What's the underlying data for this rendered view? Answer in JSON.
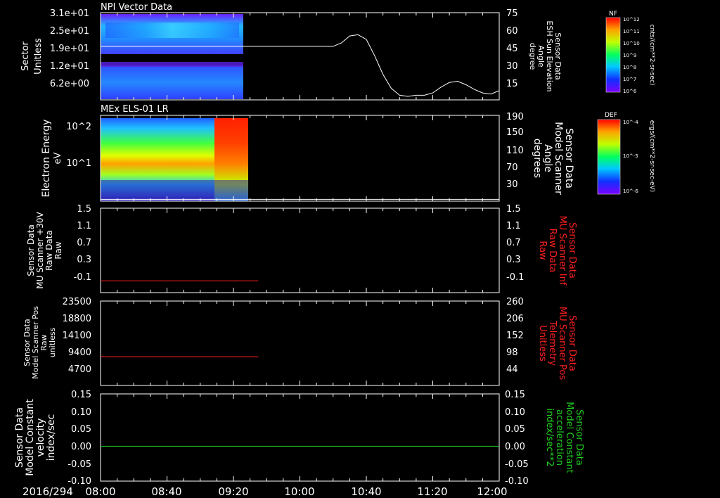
{
  "chart_data": [
    {
      "type": "heatmap",
      "title": "NPI Vector Data",
      "ylabel": "Sector",
      "yunits": "Unitless",
      "yticks": [
        "3.1e+01",
        "2.5e+01",
        "1.9e+01",
        "1.2e+01",
        "6.2e+00"
      ],
      "colorbar": {
        "label": "NF",
        "units": "cnts/(cm**2-sr-sec)",
        "ticks": [
          "10^12",
          "10^11",
          "10^10",
          "10^9",
          "10^8",
          "10^7",
          "10^6"
        ]
      },
      "overlay": {
        "type": "line",
        "name": "Sensor Data ESH Sun Elevation Angle",
        "right_label": [
          "Sensor Data",
          "ESH Sun Elevation",
          "Angle",
          "degree"
        ],
        "right_ticks": [
          "75",
          "60",
          "45",
          "30",
          "15"
        ],
        "ylim": [
          0,
          75
        ],
        "x": [
          "08:00",
          "09:00",
          "10:20",
          "10:25",
          "10:30",
          "10:35",
          "10:40",
          "10:45",
          "10:50",
          "10:55",
          "11:00",
          "11:05",
          "11:10",
          "11:15",
          "11:20",
          "11:25",
          "11:30",
          "11:35",
          "11:40",
          "11:45",
          "11:50",
          "11:55",
          "12:00"
        ],
        "values": [
          46,
          46,
          46,
          49,
          55,
          56,
          52,
          38,
          22,
          10,
          4,
          3,
          4,
          4,
          6,
          11,
          15,
          16,
          13,
          9,
          6,
          5,
          8
        ]
      }
    },
    {
      "type": "heatmap",
      "title": "MEx ELS-01 LR",
      "ylabel": "Electron Energy",
      "yunits": "eV",
      "yticks": [
        "10^2",
        "10^1"
      ],
      "colorbar": {
        "label": "DEF",
        "units": "ergs/(cm**2-sr-sec-eV)",
        "ticks": [
          "10^-4",
          "10^-5",
          "10^-6"
        ]
      },
      "overlay": {
        "type": "line",
        "name": "Sensor Data Model Scanner Angle",
        "right_label": [
          "Sensor Data",
          "Model Scanner",
          "Angle",
          "degrees"
        ],
        "right_ticks": [
          "190",
          "150",
          "110",
          "70",
          "30"
        ],
        "ylim": [
          0,
          190
        ],
        "x": [
          "08:00",
          "12:00"
        ],
        "values": [
          4,
          4
        ]
      }
    },
    {
      "type": "line",
      "ylabel_lines": [
        "Sensor Data",
        "MU Scanner +30V",
        "Raw Data",
        "Raw"
      ],
      "right_label": [
        "Sensor Data",
        "MU Scanner Inf",
        "Raw Data",
        "Raw"
      ],
      "yticks": [
        "1.5",
        "1.1",
        "0.7",
        "0.3",
        "-0.1"
      ],
      "ylim": [
        -0.3,
        1.5
      ],
      "series": [
        {
          "color": "#ff2020",
          "x": [
            "08:00",
            "09:35"
          ],
          "values": [
            -0.05,
            -0.05
          ]
        }
      ]
    },
    {
      "type": "line",
      "ylabel_lines": [
        "Sensor Data",
        "Model Scanner Pos",
        "Raw",
        "unitless"
      ],
      "right_label": [
        "Sensor Data",
        "MU Scanner Pos",
        "Telemetry",
        "Unitless"
      ],
      "yticks": [
        "23500",
        "18800",
        "14100",
        "9400",
        "4700"
      ],
      "right_ticks": [
        "260",
        "206",
        "152",
        "98",
        "44"
      ],
      "ylim": [
        0,
        23500
      ],
      "series": [
        {
          "color": "#ff2020",
          "x": [
            "08:00",
            "09:35"
          ],
          "values": [
            8000,
            8000
          ]
        }
      ]
    },
    {
      "type": "line",
      "ylabel_lines": [
        "Sensor Data",
        "Model Constant",
        "velocity",
        "index/sec"
      ],
      "right_label": [
        "Sensor Data",
        "Model Constant",
        "acceleration",
        "index/sec**2"
      ],
      "yticks": [
        "0.15",
        "0.10",
        "0.05",
        "0.00",
        "-0.05",
        "-0.10"
      ],
      "ylim": [
        -0.1,
        0.15
      ],
      "series": [
        {
          "color": "#20d020",
          "x": [
            "08:00",
            "12:00"
          ],
          "values": [
            0.0,
            0.0
          ]
        }
      ]
    }
  ],
  "xaxis": {
    "date": "2016/294",
    "ticks": [
      "08:00",
      "08:40",
      "09:20",
      "10:00",
      "10:40",
      "11:20",
      "12:00"
    ]
  }
}
